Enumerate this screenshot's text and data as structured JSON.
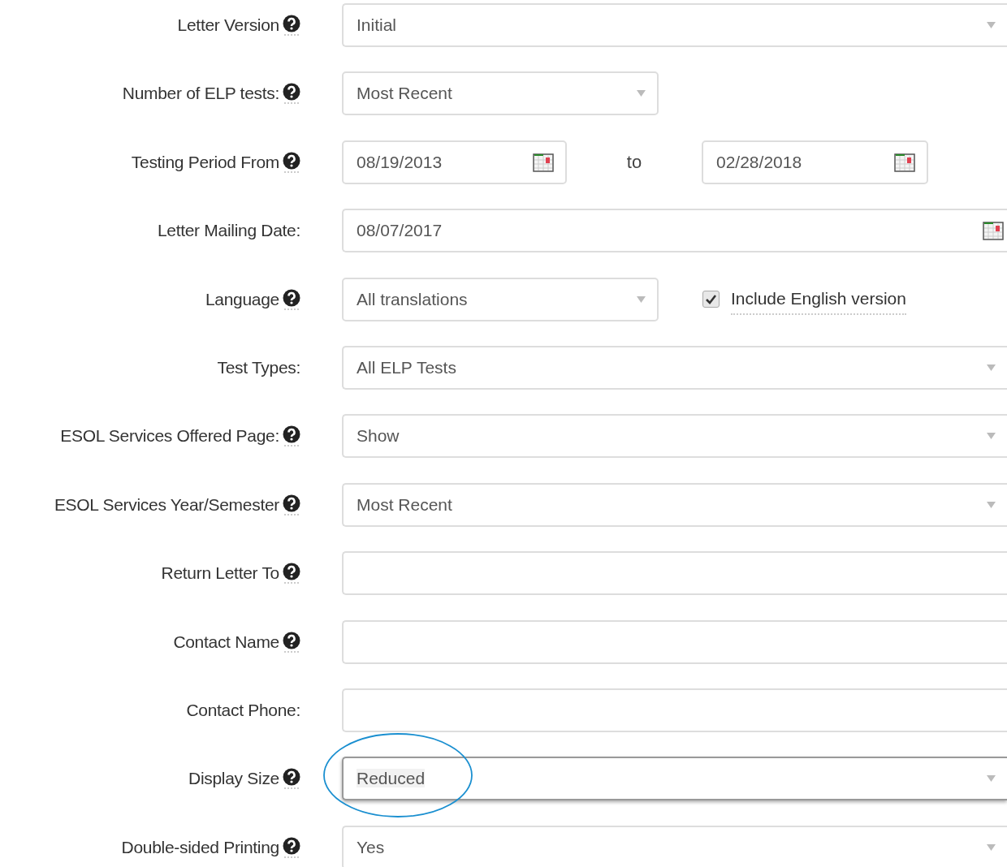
{
  "rows": [
    {
      "label": "Letter Version",
      "help": true,
      "highlighted": false,
      "kind": "select",
      "wide": true,
      "value": "Initial"
    },
    {
      "label": "Number of ELP tests:",
      "help": true,
      "highlighted": false,
      "kind": "select",
      "wide": false,
      "value": "Most Recent"
    },
    {
      "label": "Testing Period From",
      "help": true,
      "highlighted": false,
      "kind": "range",
      "value": "08/19/2013",
      "separator": "to",
      "value_to": "02/28/2018"
    },
    {
      "label": "Letter Mailing Date:",
      "help": false,
      "highlighted": false,
      "kind": "date",
      "value": "08/07/2017"
    },
    {
      "label": "Language",
      "help": true,
      "highlighted": false,
      "kind": "select",
      "wide": false,
      "value": "All translations",
      "checkbox": {
        "label": "Include English version",
        "checked": true
      }
    },
    {
      "label": "Test Types:",
      "help": false,
      "highlighted": false,
      "kind": "select",
      "wide": true,
      "value": "All ELP Tests"
    },
    {
      "label": "ESOL Services Offered Page:",
      "help": true,
      "highlighted": false,
      "kind": "select",
      "wide": true,
      "value": "Show"
    },
    {
      "label": "ESOL Services Year/Semester",
      "help": true,
      "highlighted": false,
      "kind": "select",
      "wide": true,
      "value": "Most Recent"
    },
    {
      "label": "Return Letter To",
      "help": true,
      "highlighted": false,
      "kind": "text"
    },
    {
      "label": "Contact Name",
      "help": true,
      "highlighted": false,
      "kind": "text"
    },
    {
      "label": "Contact Phone:",
      "help": false,
      "highlighted": false,
      "kind": "text"
    },
    {
      "label": "Display Size",
      "help": true,
      "highlighted": true,
      "kind": "select",
      "wide": true,
      "value": "Reduced"
    },
    {
      "label": "Double-sided Printing",
      "help": true,
      "highlighted": false,
      "kind": "select",
      "wide": true,
      "value": "Yes"
    }
  ]
}
